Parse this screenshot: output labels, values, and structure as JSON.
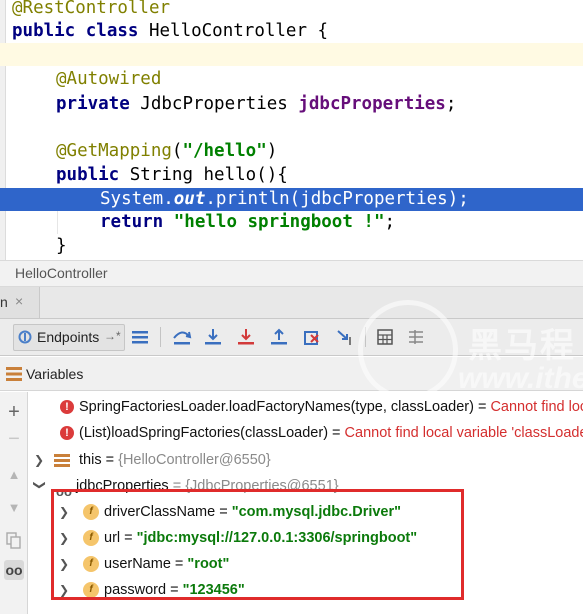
{
  "editor": {
    "lines": [
      {
        "parts": [
          {
            "cls": "ann",
            "text": "@RestController"
          }
        ]
      },
      {
        "parts": [
          {
            "cls": "kw",
            "text": "public class "
          },
          {
            "cls": "",
            "text": "HelloController {"
          }
        ]
      },
      {
        "parts": [
          {
            "cls": "",
            "text": ""
          }
        ]
      },
      {
        "parts": [
          {
            "cls": "ann",
            "text": "@Autowired"
          }
        ]
      },
      {
        "parts": [
          {
            "cls": "kw",
            "text": "private "
          },
          {
            "cls": "",
            "text": "JdbcProperties "
          },
          {
            "cls": "fld",
            "text": "jdbcProperties"
          },
          {
            "cls": "",
            "text": ";"
          }
        ]
      },
      {
        "parts": [
          {
            "cls": "",
            "text": ""
          }
        ]
      },
      {
        "parts": [
          {
            "cls": "ann",
            "text": "@GetMapping"
          },
          {
            "cls": "",
            "text": "("
          },
          {
            "cls": "str",
            "text": "\"/hello\""
          },
          {
            "cls": "",
            "text": ")"
          }
        ]
      },
      {
        "parts": [
          {
            "cls": "kw",
            "text": "public "
          },
          {
            "cls": "",
            "text": "String hello(){"
          }
        ]
      },
      {
        "parts": [
          {
            "cls": "",
            "text": "System."
          },
          {
            "cls": "itl",
            "text": "out"
          },
          {
            "cls": "",
            "text": ".println(jdbcProperties);"
          }
        ]
      },
      {
        "parts": [
          {
            "cls": "kw",
            "text": "return "
          },
          {
            "cls": "str",
            "text": "\"hello springboot !\""
          },
          {
            "cls": "",
            "text": ";"
          }
        ]
      },
      {
        "parts": [
          {
            "cls": "",
            "text": "}"
          }
        ]
      }
    ]
  },
  "breadcrumb": {
    "label": "HelloController"
  },
  "debug_tab": {
    "label": "n",
    "close": "×"
  },
  "toolbar": {
    "endpoints_label": "Endpoints",
    "endpoints_pin": "→*"
  },
  "variables_panel": {
    "title": "Variables",
    "rows": [
      {
        "kind": "error",
        "method": "SpringFactoriesLoader.loadFactoryNames(type, classLoader) = ",
        "message": "Cannot find local variable 'classLoader'"
      },
      {
        "kind": "error",
        "method": "(List)loadSpringFactories(classLoader) = ",
        "message": "Cannot find local variable 'classLoader'"
      },
      {
        "kind": "this",
        "name": "this",
        "eq": " = ",
        "value": "{HelloController@6550}"
      },
      {
        "kind": "field-ref",
        "name": "jdbcProperties",
        "eq": " = ",
        "value": "{JdbcProperties@6551}"
      },
      {
        "kind": "field",
        "name": "driverClassName",
        "eq": " = ",
        "value": "\"com.mysql.jdbc.Driver\""
      },
      {
        "kind": "field",
        "name": "url",
        "eq": " = ",
        "value": "\"jdbc:mysql://127.0.0.1:3306/springboot\""
      },
      {
        "kind": "field",
        "name": "userName",
        "eq": " = ",
        "value": "\"root\""
      },
      {
        "kind": "field",
        "name": "password",
        "eq": " = ",
        "value": "\"123456\""
      }
    ]
  },
  "watermark": {
    "brand": "黑马程",
    "url": "www.ithei"
  },
  "colors": {
    "selection": "#2f65ca",
    "annotation": "#808000",
    "keyword": "#000080",
    "string": "#008000",
    "error": "#d42e2e",
    "highlight_box": "#e02b2b"
  }
}
